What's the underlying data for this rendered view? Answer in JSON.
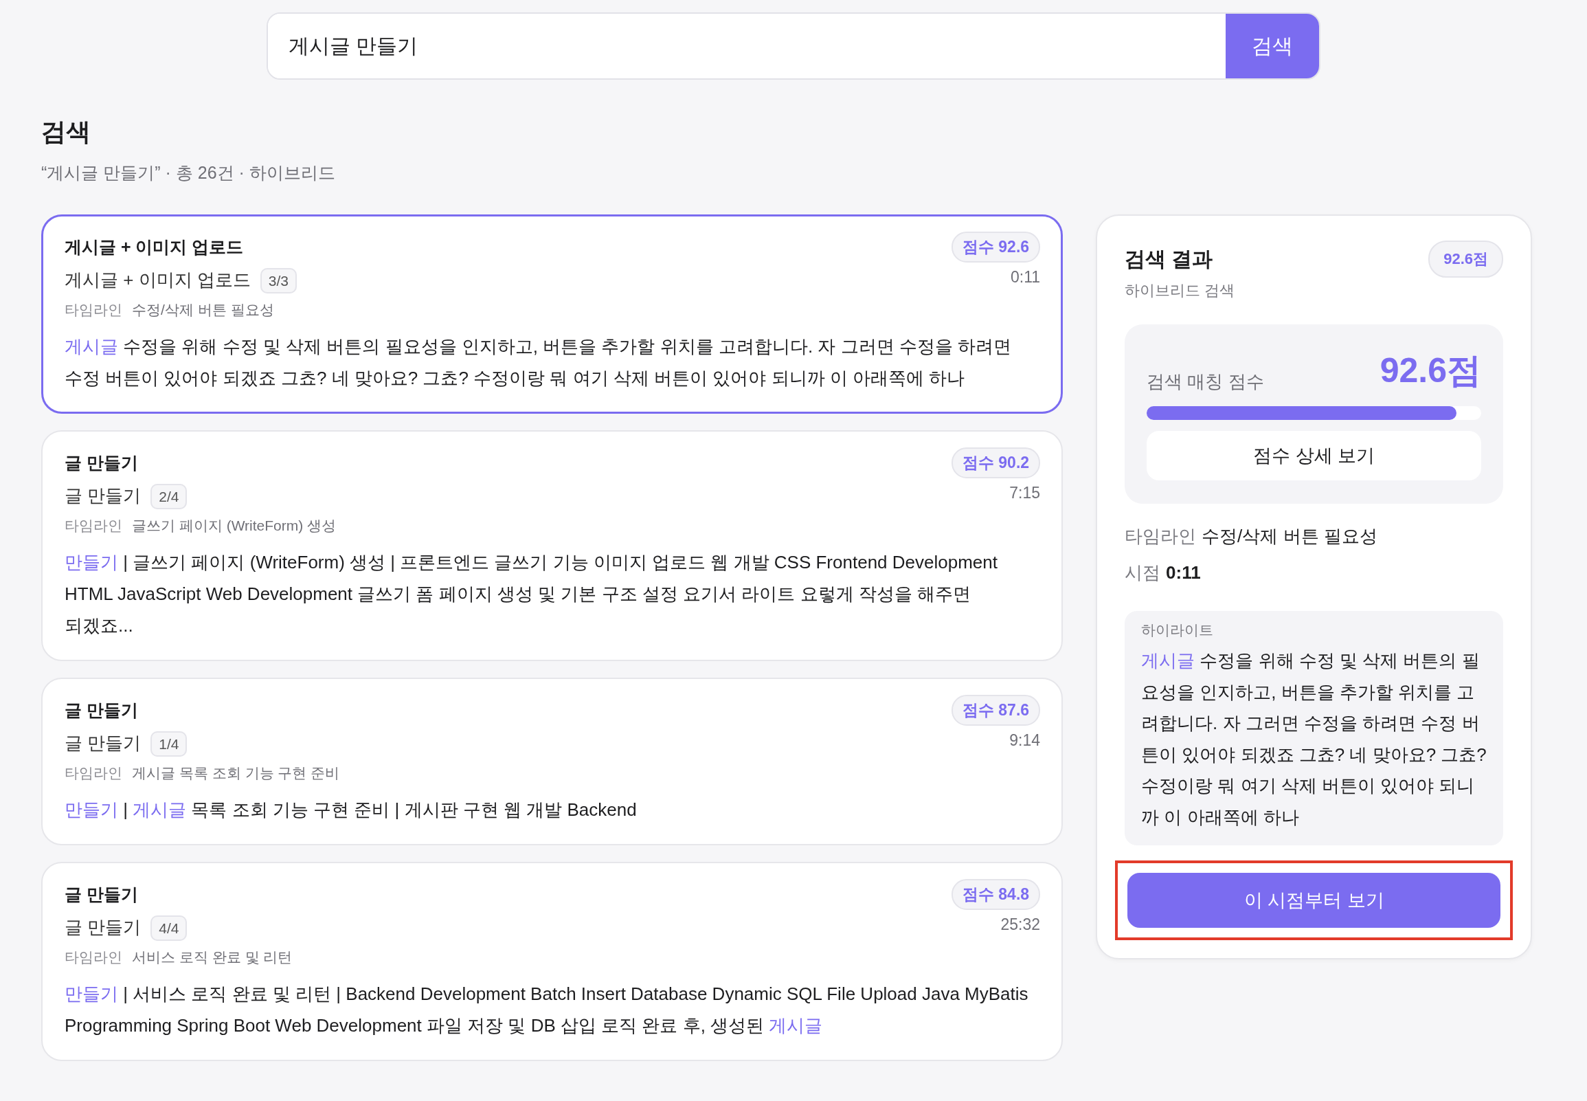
{
  "search": {
    "value": "게시글 만들기",
    "button": "검색"
  },
  "header": {
    "title": "검색",
    "summary": "“게시글 만들기” · 총 26건 · 하이브리드"
  },
  "results": [
    {
      "selected": true,
      "title": "게시글 + 이미지 업로드",
      "subtitle": "게시글 + 이미지 업로드",
      "part": "3/3",
      "score": "점수 92.6",
      "time": "0:11",
      "timeline_label": "타임라인",
      "timeline": "수정/삭제 버튼 필요성",
      "snippet": [
        {
          "text": "게시글",
          "highlight": true
        },
        {
          "text": " 수정을 위해 수정 및 삭제 버튼의 필요성을 인지하고, 버튼을 추가할 위치를 고려합니다. 자 그러면 수정을 하려면 수정 버튼이 있어야 되겠죠 그쵸? 네 맞아요? 그쵸? 수정이랑 뭐 여기 삭제 버튼이 있어야 되니까 이 아래쪽에 하나",
          "highlight": false
        }
      ]
    },
    {
      "selected": false,
      "title": "글 만들기",
      "subtitle": "글 만들기",
      "part": "2/4",
      "score": "점수 90.2",
      "time": "7:15",
      "timeline_label": "타임라인",
      "timeline": "글쓰기 페이지 (WriteForm) 생성",
      "snippet": [
        {
          "text": "만들기",
          "highlight": true
        },
        {
          "text": " | 글쓰기 페이지 (WriteForm) 생성 | 프론트엔드 글쓰기 기능 이미지 업로드 웹 개발 CSS Frontend Development HTML JavaScript Web Development 글쓰기 폼 페이지 생성 및 기본 구조 설정 요기서 라이트 요렇게 작성을 해주면 되겠죠...",
          "highlight": false
        }
      ]
    },
    {
      "selected": false,
      "title": "글 만들기",
      "subtitle": "글 만들기",
      "part": "1/4",
      "score": "점수 87.6",
      "time": "9:14",
      "timeline_label": "타임라인",
      "timeline": "게시글 목록 조회 기능 구현 준비",
      "snippet": [
        {
          "text": "만들기",
          "highlight": true
        },
        {
          "text": " | ",
          "highlight": false
        },
        {
          "text": "게시글",
          "highlight": true
        },
        {
          "text": " 목록 조회 기능 구현 준비 | 게시판 구현 웹 개발 Backend",
          "highlight": false
        }
      ]
    },
    {
      "selected": false,
      "title": "글 만들기",
      "subtitle": "글 만들기",
      "part": "4/4",
      "score": "점수 84.8",
      "time": "25:32",
      "timeline_label": "타임라인",
      "timeline": "서비스 로직 완료 및 리턴",
      "snippet": [
        {
          "text": "만들기",
          "highlight": true
        },
        {
          "text": " | 서비스 로직 완료 및 리턴 | Backend Development Batch Insert Database Dynamic SQL File Upload Java MyBatis Programming Spring Boot Web Development 파일 저장 및 DB 삽입 로직 완료 후, 생성된 ",
          "highlight": false
        },
        {
          "text": "게시글",
          "highlight": true
        }
      ]
    }
  ],
  "detail": {
    "title": "검색 결과",
    "badge": "92.6점",
    "subtitle": "하이브리드 검색",
    "score_label": "검색 매칭 점수",
    "score_value": "92.6점",
    "level": 0.926,
    "score_button": "점수 상세 보기",
    "timeline_label": "타임라인",
    "timeline": "수정/삭제 버튼 필요성",
    "time_label": "시점",
    "time": "0:11",
    "highlight_label": "하이라이트",
    "highlight": [
      {
        "text": "게시글",
        "highlight": true
      },
      {
        "text": " 수정을 위해 수정 및 삭제 버튼의 필요성을 인지하고, 버튼을 추가할 위치를 고려합니다. 자 그러면 수정을 하려면 수정 버튼이 있어야 되겠죠 그쵸? 네 맞아요? 그쵸? 수정이랑 뭐 여기 삭제 버튼이 있어야 되니까 이 아래쪽에 하나",
        "highlight": false
      }
    ],
    "play_button": "이 시점부터 보기",
    "play_button_marked": true
  }
}
